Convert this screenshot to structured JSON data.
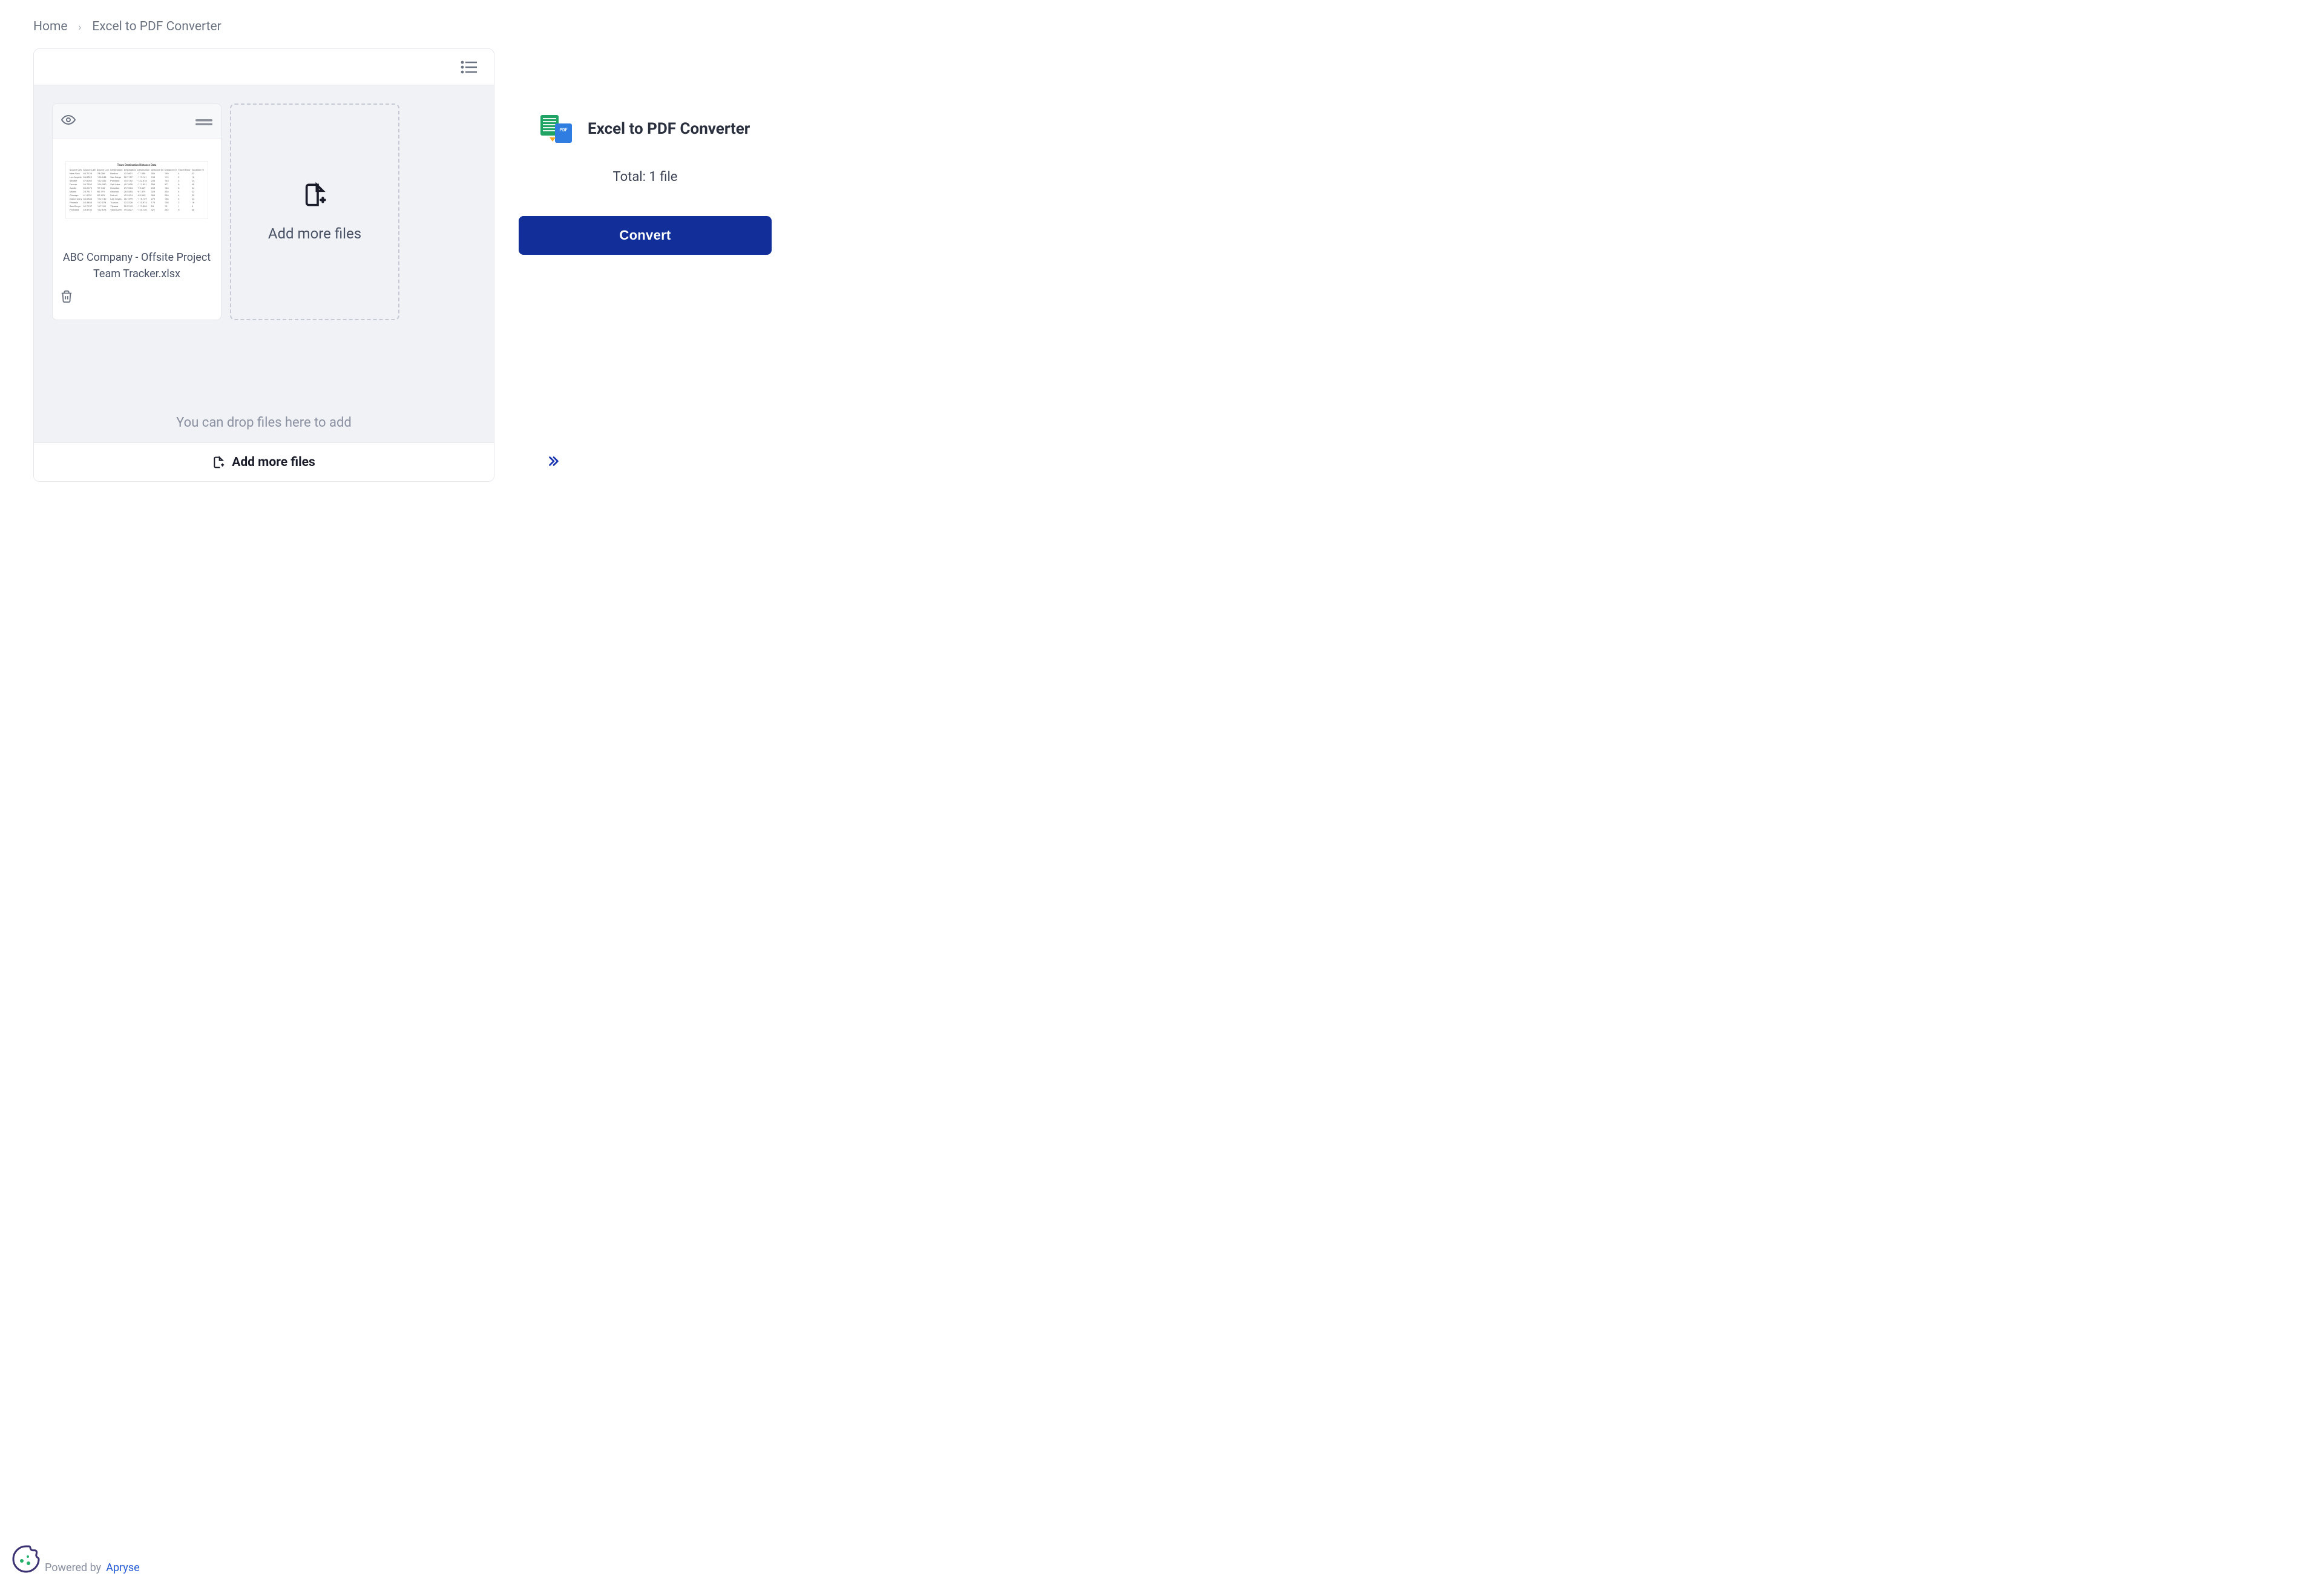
{
  "breadcrumb": {
    "home": "Home",
    "current": "Excel to PDF Converter"
  },
  "files": {
    "card0_name": "ABC Company - Offsite Project Team Tracker.xlsx"
  },
  "add_tile_label": "Add more files",
  "drop_hint": "You can drop files here to add",
  "footer_add_label": "Add more files",
  "right": {
    "title": "Excel to PDF Converter",
    "total": "Total: 1 file",
    "convert": "Convert"
  },
  "powered": {
    "prefix": "Powered by",
    "vendor": "Apryse"
  }
}
